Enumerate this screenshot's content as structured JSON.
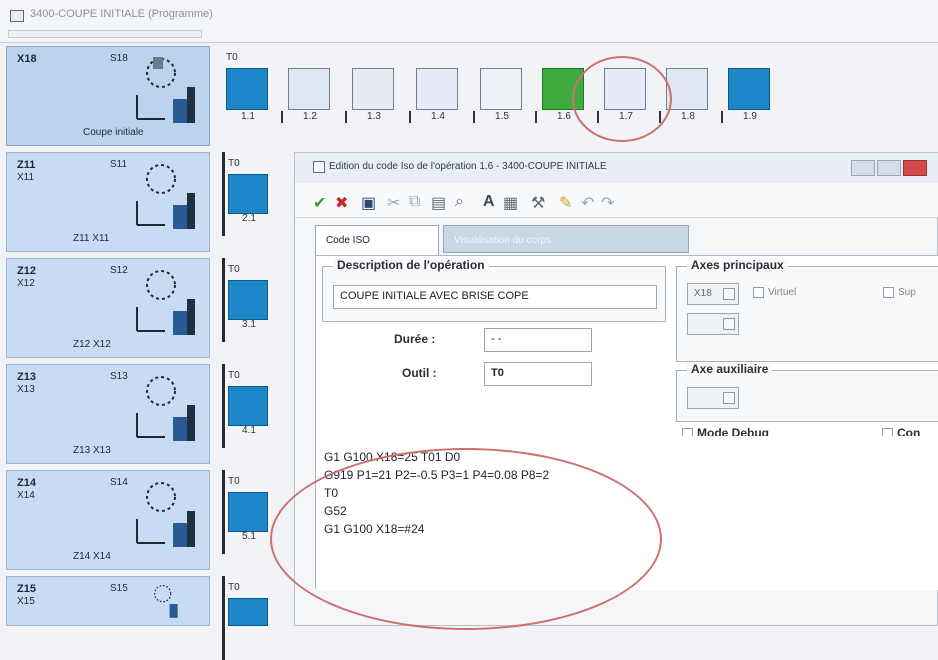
{
  "main_window": {
    "title": "3400-COUPE INITIALE (Programme)"
  },
  "groups": [
    {
      "x": "X18",
      "s": "S18",
      "label": "Coupe initiale",
      "sublabel": ""
    },
    {
      "x": "Z11",
      "x2": "X11",
      "s": "S11",
      "label": "Z11 X11"
    },
    {
      "x": "Z12",
      "x2": "X12",
      "s": "S12",
      "label": "Z12 X12"
    },
    {
      "x": "Z13",
      "x2": "X13",
      "s": "S13",
      "label": "Z13 X13"
    },
    {
      "x": "Z14",
      "x2": "X14",
      "s": "S14",
      "label": "Z14 X14"
    },
    {
      "x": "Z15",
      "x2": "X15",
      "s": "S15",
      "label": ""
    }
  ],
  "left_tools": [
    {
      "t": "T0",
      "num": "2.1"
    },
    {
      "t": "T0",
      "num": "3.1"
    },
    {
      "t": "T0",
      "num": "4.1"
    },
    {
      "t": "T0",
      "num": "5.1"
    },
    {
      "t": "T0",
      "num": ""
    }
  ],
  "top_tools": {
    "t0": "T0",
    "items": [
      {
        "num": "1.1"
      },
      {
        "num": "1.2"
      },
      {
        "num": "1.3"
      },
      {
        "num": "1.4"
      },
      {
        "num": "1.5"
      },
      {
        "num": "1.6"
      },
      {
        "num": "1.7"
      },
      {
        "num": "1.8"
      },
      {
        "num": "1.9"
      }
    ]
  },
  "dialog": {
    "title": "Edition du code Iso de l'opération 1.6 - 3400-COUPE INITIALE",
    "tabs": [
      {
        "label": "Code ISO",
        "active": true
      },
      {
        "label": "Visualisation du corps",
        "active": false
      }
    ],
    "description": {
      "legend": "Description de l'opération",
      "value": "COUPE INITIALE AVEC BRISE COPE"
    },
    "axes_principaux": {
      "legend": "Axes principaux",
      "select_value": "X18",
      "virtuel_label": "Virtuel",
      "sup_label": "Sup"
    },
    "duree": {
      "label": "Durée :",
      "value": "- -"
    },
    "outil": {
      "label": "Outil :",
      "value": "T0"
    },
    "axe_auxiliaire": {
      "legend": "Axe auxiliaire"
    },
    "mode_debug": {
      "label": "Mode Debug"
    },
    "con_label": "Con",
    "code_lines": [
      "G1 G100 X18=25 T01 D0",
      "G919 P1=21 P2=-0.5 P3=1 P4=0.08 P8=2",
      "T0",
      "G52",
      "G1 G100 X18=#24"
    ]
  },
  "colors": {
    "tool_blue": "#1c86c8",
    "tool_green": "#3faa3f",
    "highlight_red": "#cf6f6f",
    "group_blue": "#c7dbf2"
  }
}
